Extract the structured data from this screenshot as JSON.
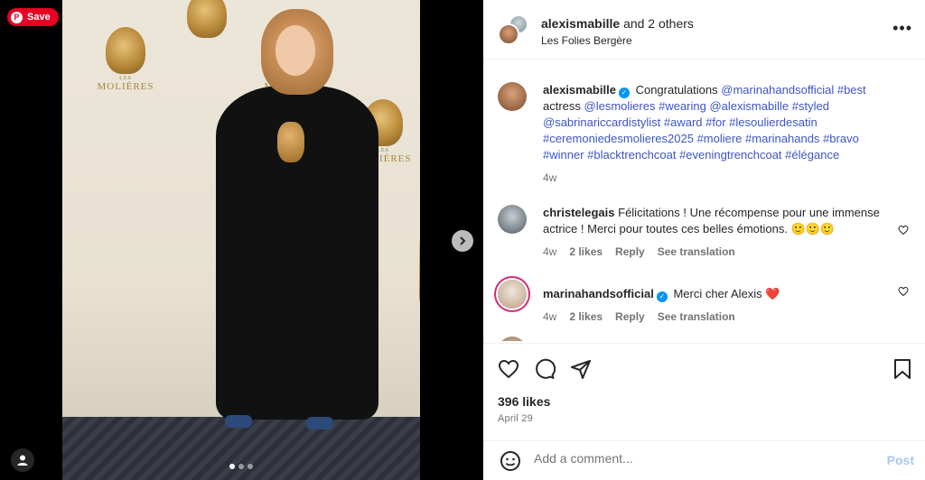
{
  "save_button": {
    "label": "Save"
  },
  "header": {
    "username": "alexismabille",
    "others": "and 2 others",
    "location": "Les Folies Bergère",
    "more": "•••"
  },
  "backdrop": {
    "les": "LES",
    "molieres": "MOLIÈRES"
  },
  "caption": {
    "user": "alexismabille",
    "text_parts": [
      {
        "t": "Congratulations ",
        "tag": false
      },
      {
        "t": "@marinahandsofficial",
        "tag": true
      },
      {
        "t": " ",
        "tag": false
      },
      {
        "t": "#best",
        "tag": true
      },
      {
        "t": " actress ",
        "tag": false
      },
      {
        "t": "@lesmolieres",
        "tag": true
      },
      {
        "t": " ",
        "tag": false
      },
      {
        "t": "#wearing",
        "tag": true
      },
      {
        "t": " ",
        "tag": false
      },
      {
        "t": "@alexismabille",
        "tag": true
      },
      {
        "t": " ",
        "tag": false
      },
      {
        "t": "#styled",
        "tag": true
      },
      {
        "t": " ",
        "tag": false
      },
      {
        "t": "@sabrinariccardistylist",
        "tag": true
      },
      {
        "t": " ",
        "tag": false
      },
      {
        "t": "#award",
        "tag": true
      },
      {
        "t": " ",
        "tag": false
      },
      {
        "t": "#for",
        "tag": true
      },
      {
        "t": " ",
        "tag": false
      },
      {
        "t": "#lesoulierdesatin",
        "tag": true
      },
      {
        "t": " ",
        "tag": false
      },
      {
        "t": "#ceremoniedesmolieres2025",
        "tag": true
      },
      {
        "t": " ",
        "tag": false
      },
      {
        "t": "#moliere",
        "tag": true
      },
      {
        "t": " ",
        "tag": false
      },
      {
        "t": "#marinahands",
        "tag": true
      },
      {
        "t": " ",
        "tag": false
      },
      {
        "t": "#bravo",
        "tag": true
      },
      {
        "t": " ",
        "tag": false
      },
      {
        "t": "#winner",
        "tag": true
      },
      {
        "t": " ",
        "tag": false
      },
      {
        "t": "#blacktrenchcoat",
        "tag": true
      },
      {
        "t": " ",
        "tag": false
      },
      {
        "t": "#eveningtrenchcoat",
        "tag": true
      },
      {
        "t": " ",
        "tag": false
      },
      {
        "t": "#élégance",
        "tag": true
      }
    ],
    "time": "4w"
  },
  "comments": [
    {
      "user": "christelegais",
      "text": "Félicitations ! Une récompense pour une immense actrice ! Merci pour toutes ces belles émotions. 🙂🙂🙂",
      "time": "4w",
      "likes": "2 likes",
      "reply": "Reply",
      "translate": "See translation"
    },
    {
      "user": "marinahandsofficial",
      "text": "Merci cher Alexis ❤️",
      "time": "4w",
      "likes": "2 likes",
      "reply": "Reply",
      "translate": "See translation"
    }
  ],
  "likes_count": "396 likes",
  "post_date": "April 29",
  "add_comment": {
    "placeholder": "Add a comment...",
    "post_label": "Post"
  },
  "colors": {
    "accent": "#0095f6",
    "tag": "#3c55c6",
    "save": "#e60023",
    "post_disabled": "#a7c8f2"
  }
}
